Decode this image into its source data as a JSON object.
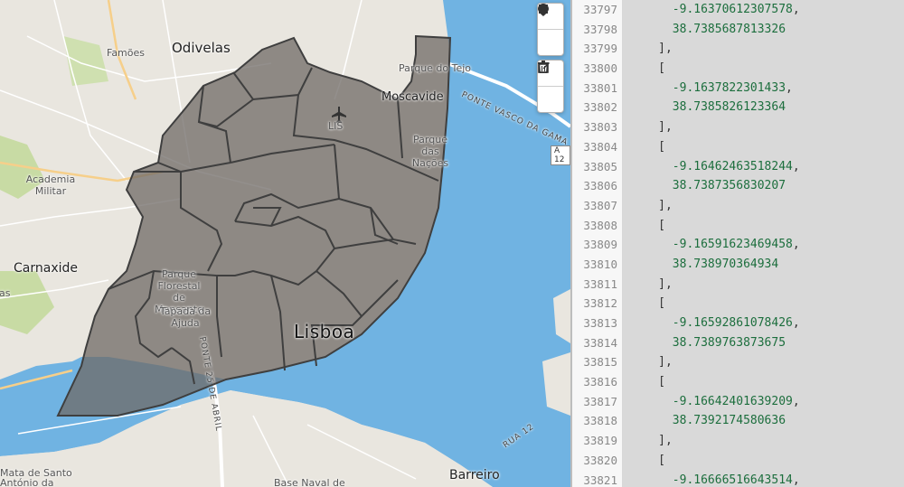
{
  "map": {
    "labels": {
      "famoes": "Famões",
      "odivelas": "Odivelas",
      "moscavide": "Moscavide",
      "parque_do_tejo": "Parque do Tejo",
      "ponte_vasco": "PONTE VASCO DA GAMA",
      "lis": "LIS",
      "parque_nacoes": "Parque das Nações",
      "academia": "Academia Militar",
      "carnaxide": "Carnaxide",
      "parque_florestal": "Parque Florestal de Monsanto",
      "tapada": "Tapada da Ajuda",
      "lisboa": "Lisboa",
      "ponte_25": "PONTE 25 DE ABRIL",
      "barreiro": "Barreiro",
      "rua12": "RUA 12",
      "base_naval": "Base Naval de",
      "mata_santo": "Mata de Santo",
      "antonio": "António da",
      "as": "as",
      "a12": "A 12"
    },
    "tools": [
      {
        "name": "draw-polygon",
        "icon": "square-icon"
      },
      {
        "name": "draw-marker",
        "icon": "marker-icon"
      },
      {
        "name": "edit-layers",
        "icon": "edit-icon"
      },
      {
        "name": "delete-layers",
        "icon": "trash-icon"
      }
    ],
    "colors": {
      "water": "#70b3e2",
      "land": "#e9e6df",
      "park": "#c8dba4",
      "overlay": "#6f6a66",
      "border": "#3f3f3f"
    }
  },
  "editor": {
    "line_numbers": [
      "33797",
      "33798",
      "33799",
      "33800",
      "33801",
      "33802",
      "33803",
      "33804",
      "33805",
      "33806",
      "33807",
      "33808",
      "33809",
      "33810",
      "33811",
      "33812",
      "33813",
      "33814",
      "33815",
      "33816",
      "33817",
      "33818",
      "33819",
      "33820",
      "33821"
    ],
    "lines": [
      {
        "indent": "       ",
        "text": "-9.16370612307578,"
      },
      {
        "indent": "       ",
        "text": "38.7385687813326"
      },
      {
        "indent": "     ",
        "text": "],"
      },
      {
        "indent": "     ",
        "text": "["
      },
      {
        "indent": "       ",
        "text": "-9.1637822301433,"
      },
      {
        "indent": "       ",
        "text": "38.7385826123364"
      },
      {
        "indent": "     ",
        "text": "],"
      },
      {
        "indent": "     ",
        "text": "["
      },
      {
        "indent": "       ",
        "text": "-9.16462463518244,"
      },
      {
        "indent": "       ",
        "text": "38.7387356830207"
      },
      {
        "indent": "     ",
        "text": "],"
      },
      {
        "indent": "     ",
        "text": "["
      },
      {
        "indent": "       ",
        "text": "-9.16591623469458,"
      },
      {
        "indent": "       ",
        "text": "38.738970364934"
      },
      {
        "indent": "     ",
        "text": "],"
      },
      {
        "indent": "     ",
        "text": "["
      },
      {
        "indent": "       ",
        "text": "-9.16592861078426,"
      },
      {
        "indent": "       ",
        "text": "38.7389763873675"
      },
      {
        "indent": "     ",
        "text": "],"
      },
      {
        "indent": "     ",
        "text": "["
      },
      {
        "indent": "       ",
        "text": "-9.16642401639209,"
      },
      {
        "indent": "       ",
        "text": "38.7392174580636"
      },
      {
        "indent": "     ",
        "text": "],"
      },
      {
        "indent": "     ",
        "text": "["
      },
      {
        "indent": "       ",
        "text": "-9.16666516643514,"
      }
    ]
  }
}
